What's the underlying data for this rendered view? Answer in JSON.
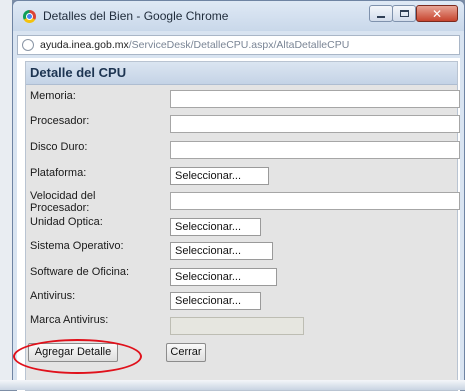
{
  "window": {
    "title": "Detalles del Bien - Google Chrome",
    "icon": "chrome-icon",
    "controls": [
      "minimize-icon",
      "maximize-icon",
      "close-icon"
    ],
    "close_glyph": "✕"
  },
  "address": {
    "host": "ayuda.inea.gob.mx",
    "path": "/ServiceDesk/DetalleCPU.aspx/AltaDetalleCPU"
  },
  "form": {
    "title": "Detalle del CPU",
    "fields": {
      "memoria": {
        "label": "Memoria:",
        "value": ""
      },
      "procesador": {
        "label": "Procesador:",
        "value": ""
      },
      "disco_duro": {
        "label": "Disco Duro:",
        "value": ""
      },
      "plataforma": {
        "label": "Plataforma:",
        "value": "Seleccionar..."
      },
      "velocidad": {
        "label": "Velocidad del Procesador:",
        "value": ""
      },
      "unidad_optica": {
        "label": "Unidad Optica:",
        "value": "Seleccionar..."
      },
      "sistema_operativo": {
        "label": "Sistema Operativo:",
        "value": "Seleccionar..."
      },
      "software_oficina": {
        "label": "Software de Oficina:",
        "value": "Seleccionar..."
      },
      "antivirus": {
        "label": "Antivirus:",
        "value": "Seleccionar..."
      },
      "marca_antivirus": {
        "label": "Marca Antivirus:",
        "value": ""
      }
    },
    "buttons": {
      "agregar": "Agregar Detalle",
      "cerrar": "Cerrar"
    }
  },
  "colors": {
    "annotation": "#e0111b",
    "panel_title": "#1d3451",
    "panel_background": "#e4e4e4"
  }
}
